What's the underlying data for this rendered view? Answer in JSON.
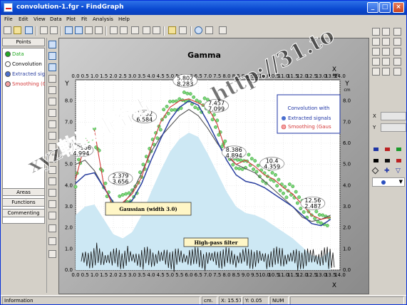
{
  "window": {
    "title": "convolution-1.fgr - FindGraph",
    "minimize": "_",
    "maximize": "□",
    "close": "×"
  },
  "menu": [
    "File",
    "Edit",
    "View",
    "Data",
    "Plot",
    "Fit",
    "Analysis",
    "Help"
  ],
  "left_panel": {
    "tab_points": "Points",
    "items": [
      {
        "label": "Data",
        "color": "#22aa22"
      },
      {
        "label": "Convolution",
        "color": "#ffffff"
      },
      {
        "label": "Extracted sig",
        "color": "#4a6fcf"
      },
      {
        "label": "Smoothing (G",
        "color": "#e06060"
      }
    ],
    "tab_areas": "Areas",
    "tab_functions": "Functions",
    "tab_commenting": "Commenting"
  },
  "chart_data": {
    "type": "scatter",
    "title": "Gamma",
    "x_axis_label": "X",
    "y_axis_label": "Y",
    "x_unit": "cm",
    "y_unit": "cm",
    "xlim": [
      0,
      14
    ],
    "ylim": [
      0,
      9
    ],
    "x_ticks": [
      "0.0",
      "0.5",
      "1.0",
      "1.5",
      "2.0",
      "2.5",
      "3.0",
      "3.5",
      "4.0",
      "4.5",
      "5.0",
      "5.5",
      "6.0",
      "6.5",
      "7.0",
      "7.5",
      "8.0",
      "8.5",
      "9.0",
      "9.5",
      "10.0",
      "10.5",
      "11.0",
      "11.5",
      "12.0",
      "12.5",
      "13.0",
      "13.5",
      "14.0"
    ],
    "y_ticks": [
      "0.0",
      "1.0",
      "2.0",
      "3.0",
      "4.0",
      "5.0",
      "6.0",
      "7.0",
      "8.0"
    ],
    "legend": {
      "title": "Convolution with",
      "entries": [
        "Extracted signals",
        "Smoothing (Gaus"
      ]
    },
    "series": [
      {
        "name": "Convolution",
        "color": "#ffffff",
        "x": [
          0,
          0.5,
          1,
          1.5,
          2,
          2.5,
          3,
          3.5,
          4,
          4.5,
          5,
          5.5,
          6,
          6.5,
          7,
          7.5,
          8,
          8.5,
          9,
          9.5,
          10,
          10.5,
          11,
          11.5,
          12,
          12.5,
          13,
          13.5
        ],
        "y": [
          5.0,
          5.2,
          4.7,
          3.9,
          3.2,
          3.1,
          3.7,
          4.6,
          5.6,
          6.3,
          6.8,
          7.3,
          7.6,
          7.3,
          6.7,
          6.0,
          5.4,
          5.0,
          4.8,
          4.6,
          4.2,
          3.8,
          3.4,
          3.0,
          2.5,
          2.3,
          2.4,
          2.6
        ]
      },
      {
        "name": "Extracted signals",
        "color": "#2a3f9f",
        "x": [
          0,
          0.5,
          1,
          1.5,
          2,
          2.5,
          3,
          3.5,
          4,
          4.5,
          5,
          5.5,
          6,
          6.5,
          7,
          7.5,
          8,
          8.5,
          9,
          9.5,
          10,
          10.5,
          11,
          11.5,
          12,
          12.5,
          13,
          13.5
        ],
        "y": [
          4.1,
          4.5,
          4.6,
          3.9,
          3.2,
          3.0,
          3.3,
          4.1,
          5.2,
          6.2,
          7.1,
          7.7,
          8.0,
          7.8,
          7.0,
          6.1,
          5.2,
          4.5,
          4.2,
          4.1,
          3.9,
          3.6,
          3.3,
          3.0,
          2.6,
          2.2,
          2.1,
          2.4
        ]
      },
      {
        "name": "Smoothing (Gaus",
        "color": "#d43a3a",
        "x": [
          0,
          0.5,
          1,
          1.5,
          2,
          2.5,
          3,
          3.5,
          4,
          4.5,
          5,
          5.5,
          6,
          6.5,
          7,
          7.5,
          8,
          8.5,
          9,
          9.5,
          10,
          10.5,
          11,
          11.5,
          12,
          12.5,
          13,
          13.5
        ],
        "y": [
          4.3,
          6.0,
          6.6,
          4.0,
          3.0,
          3.2,
          3.6,
          4.4,
          5.8,
          7.0,
          7.7,
          8.0,
          8.1,
          7.9,
          7.7,
          6.9,
          5.5,
          5.0,
          5.2,
          4.9,
          4.5,
          4.3,
          3.9,
          3.6,
          3.1,
          2.6,
          2.4,
          2.5
        ]
      }
    ],
    "peaks": [
      {
        "x": 0.2966,
        "h": 4.994,
        "label_x": "0.2966",
        "label_h": "4.994"
      },
      {
        "x": 2.379,
        "h": 3.656,
        "label_x": "2.379",
        "label_h": "3.656"
      },
      {
        "x": 3.652,
        "h": 6.584,
        "label_x": "3.652",
        "label_h": "6.584"
      },
      {
        "x": 5.802,
        "h": 8.283,
        "label_x": "5.802",
        "label_h": "8.283"
      },
      {
        "x": 7.457,
        "h": 7.099,
        "label_x": "7.457",
        "label_h": "7.099"
      },
      {
        "x": 8.386,
        "h": 4.894,
        "label_x": "8.386",
        "label_h": "4.894"
      },
      {
        "x": 10.4,
        "h": 4.359,
        "label_x": "10.4",
        "label_h": "4.359"
      },
      {
        "x": 12.56,
        "h": 2.487,
        "label_x": "12.56",
        "label_h": "2.487"
      }
    ],
    "annotations": {
      "gaussian_note": "Gaussian (width 3.0)",
      "highpass_note": "High-pass filter"
    }
  },
  "right_panel": {
    "x_label": "X",
    "y_label": "Y"
  },
  "status": {
    "info": "Information",
    "unit": "cm.",
    "x": "X:  15.57",
    "y": "Y:  0.05",
    "num": "NUM"
  },
  "watermark": {
    "left": "xyz軟體補給站",
    "right": "http://31.to"
  }
}
